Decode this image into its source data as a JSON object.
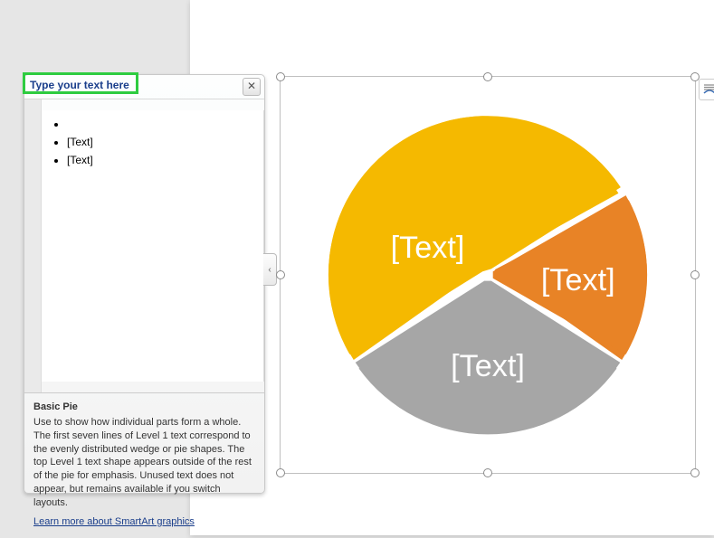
{
  "textpane": {
    "title": "Type your text here",
    "close": "✕",
    "items": [
      "",
      "[Text]",
      "[Text]"
    ],
    "desc_title": "Basic Pie",
    "desc_body": "Use to show how individual parts form a whole. The first seven lines of Level 1 text correspond to the evenly distributed wedge or pie shapes. The top Level 1 text shape appears outside of the rest of the pie for emphasis. Unused text does not appear, but remains available if you switch layouts.",
    "learn_link": "Learn more about SmartArt graphics"
  },
  "expand_tab": "‹",
  "chart_data": {
    "type": "pie",
    "title": "",
    "series": [
      {
        "name": "[Text]",
        "value": 1,
        "color": "#e88326"
      },
      {
        "name": "[Text]",
        "value": 1,
        "color": "#a6a6a6"
      },
      {
        "name": "[Text]",
        "value": 1,
        "color": "#f5b900"
      }
    ]
  }
}
